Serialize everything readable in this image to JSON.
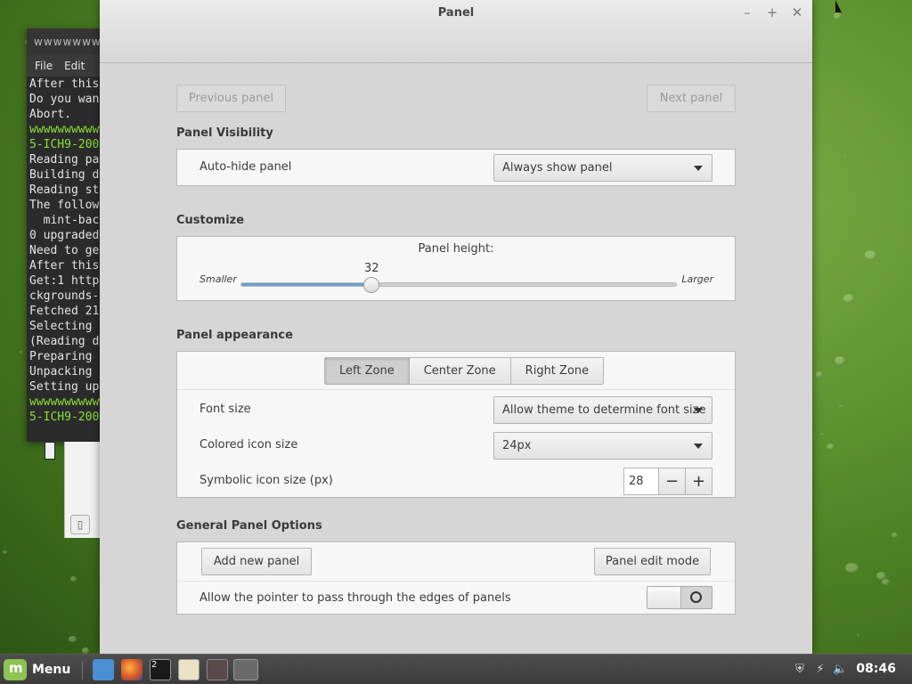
{
  "window": {
    "title": "Panel"
  },
  "nav": {
    "previous": "Previous panel",
    "next": "Next panel"
  },
  "visibility": {
    "heading": "Panel Visibility",
    "autohide_label": "Auto-hide panel",
    "autohide_value": "Always show panel"
  },
  "customize": {
    "heading": "Customize",
    "panel_height_label": "Panel height:",
    "value": "32",
    "slider_fraction": 0.3,
    "min_label": "Smaller",
    "max_label": "Larger"
  },
  "appearance": {
    "heading": "Panel appearance",
    "zones": [
      "Left Zone",
      "Center Zone",
      "Right Zone"
    ],
    "active_zone": "Left Zone",
    "font_size_label": "Font size",
    "font_size_value": "Allow theme to determine font size",
    "colored_icon_label": "Colored icon size",
    "colored_icon_value": "24px",
    "symbolic_icon_label": "Symbolic icon size (px)",
    "symbolic_icon_value": "28",
    "minus": "−",
    "plus": "+"
  },
  "general": {
    "heading": "General Panel Options",
    "add_panel": "Add new panel",
    "edit_mode": "Panel edit mode",
    "pointer_pass_label": "Allow the pointer to pass through the edges of panels",
    "pointer_pass_enabled": false
  },
  "terminal": {
    "title": "wwwwwww",
    "menu": [
      "File",
      "Edit"
    ],
    "lines": [
      {
        "t": "After this",
        "c": "w"
      },
      {
        "t": "Do you wan",
        "c": "w"
      },
      {
        "t": "Abort.",
        "c": "w"
      },
      {
        "t": "wwwwwwwwwww",
        "c": "g"
      },
      {
        "t": "5-ICH9-200",
        "c": "g"
      },
      {
        "t": "Reading pa",
        "c": "w"
      },
      {
        "t": "Building d",
        "c": "w"
      },
      {
        "t": "Reading st",
        "c": "w"
      },
      {
        "t": "The follow",
        "c": "w"
      },
      {
        "t": "  mint-bac",
        "c": "w"
      },
      {
        "t": "0 upgraded",
        "c": "w"
      },
      {
        "t": "Need to ge",
        "c": "w"
      },
      {
        "t": "After this",
        "c": "w"
      },
      {
        "t": "Get:1 http",
        "c": "w"
      },
      {
        "t": "ckgrounds-",
        "c": "w"
      },
      {
        "t": "Fetched 21",
        "c": "w"
      },
      {
        "t": "Selecting ",
        "c": "w"
      },
      {
        "t": "(Reading d",
        "c": "w"
      },
      {
        "t": "Preparing ",
        "c": "w"
      },
      {
        "t": "Unpacking ",
        "c": "w"
      },
      {
        "t": "Setting up",
        "c": "w"
      },
      {
        "t": "wwwwwwwwwww",
        "c": "g"
      },
      {
        "t": "5-ICH9-200",
        "c": "g"
      }
    ]
  },
  "taskbar": {
    "menu_label": "Menu",
    "terminal_badge": "2",
    "clock": "08:46",
    "colors": {
      "accent": "#6a9fce",
      "mint": "#8cc352"
    }
  }
}
